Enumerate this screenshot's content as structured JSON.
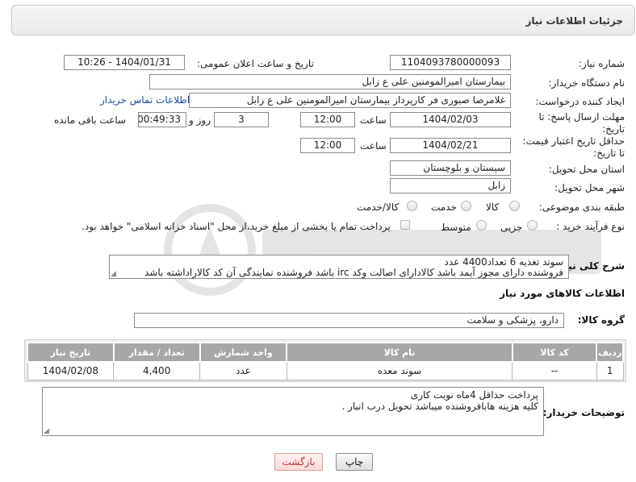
{
  "header": {
    "title": "جزئیات اطلاعات نیاز"
  },
  "form": {
    "need_number_label": "شماره نیاز:",
    "need_number": "1104093780000093",
    "announce_label": "تاریخ و ساعت اعلان عمومی:",
    "announce_value": "1404/01/31 - 10:26",
    "buyer_org_label": "نام دستگاه خریدار:",
    "buyer_org": "بیمارستان امیرالمومنین علی  ع  زابل",
    "creator_label": "ایجاد کننده درخواست:",
    "creator": "غلامرضا صبوری فر کارپرداز بیمارستان امیرالمومنین علی  ع  زابل",
    "contact_link": "اطلاعات تماس خریدار",
    "deadline_label_1": "مهلت ارسال پاسخ: تا",
    "deadline_label_2": "تاریخ:",
    "deadline_date": "1404/02/03",
    "time_label": "ساعت",
    "deadline_time": "12:00",
    "days_value": "3",
    "days_label": "روز و",
    "remaining_time": "00:49:33",
    "remaining_label": "ساعت باقی مانده",
    "validity_label_1": "حداقل تاریخ اعتبار قیمت:",
    "validity_label_2": "تا تاریخ:",
    "validity_date": "1404/02/21",
    "validity_time": "12:00",
    "province_label": "استان محل تحویل:",
    "province": "سیستان و بلوچستان",
    "city_label": "شهر محل تحویل:",
    "city": "زابل",
    "category_label": "طبقه بندی موضوعی:",
    "category_options": [
      "کالا",
      "خدمت",
      "کالا/خدمت"
    ],
    "process_label": "نوع فرآیند خرید :",
    "process_options": [
      "جزیی",
      "متوسط"
    ],
    "payment_note": "پرداخت تمام یا بخشی از مبلغ خرید،از محل \"اسناد خزانه اسلامی\" خواهد بود."
  },
  "description": {
    "label": "شرح کلی نیاز:",
    "line1": "سوند تغذیه 6 تعداد4400 عدد",
    "line2": "فروشنده دارای مجوز آیمد باشد کالادارای اصالت وکد irc باشد فروشنده نمایندگی آن کد کالاراداشته باشد"
  },
  "goods": {
    "section_title": "اطلاعات کالاهای مورد نیاز",
    "group_label": "گروه کالا:",
    "group_value": "دارو، پزشکی و سلامت",
    "columns": [
      "ردیف",
      "کد کالا",
      "نام کالا",
      "واحد شمارش",
      "تعداد / مقدار",
      "تاریخ نیاز"
    ],
    "rows": [
      {
        "row": "1",
        "code": "--",
        "name": "سوند معده",
        "unit": "عدد",
        "qty": "4,400",
        "date": "1404/02/08"
      }
    ]
  },
  "buyer_notes": {
    "label": "توضیحات خریدار:",
    "line1": "پرداخت حداقل 4ماه نوبت کاری",
    "line2": "کلیه هزینه هابافروشنده میباشد تحویل درب انبار ."
  },
  "buttons": {
    "print": "چاپ",
    "back": "بازگشت"
  },
  "colors": {
    "table_header": "#a7a7a7",
    "link": "#1a4fa0",
    "back_text": "#b83a3a"
  }
}
